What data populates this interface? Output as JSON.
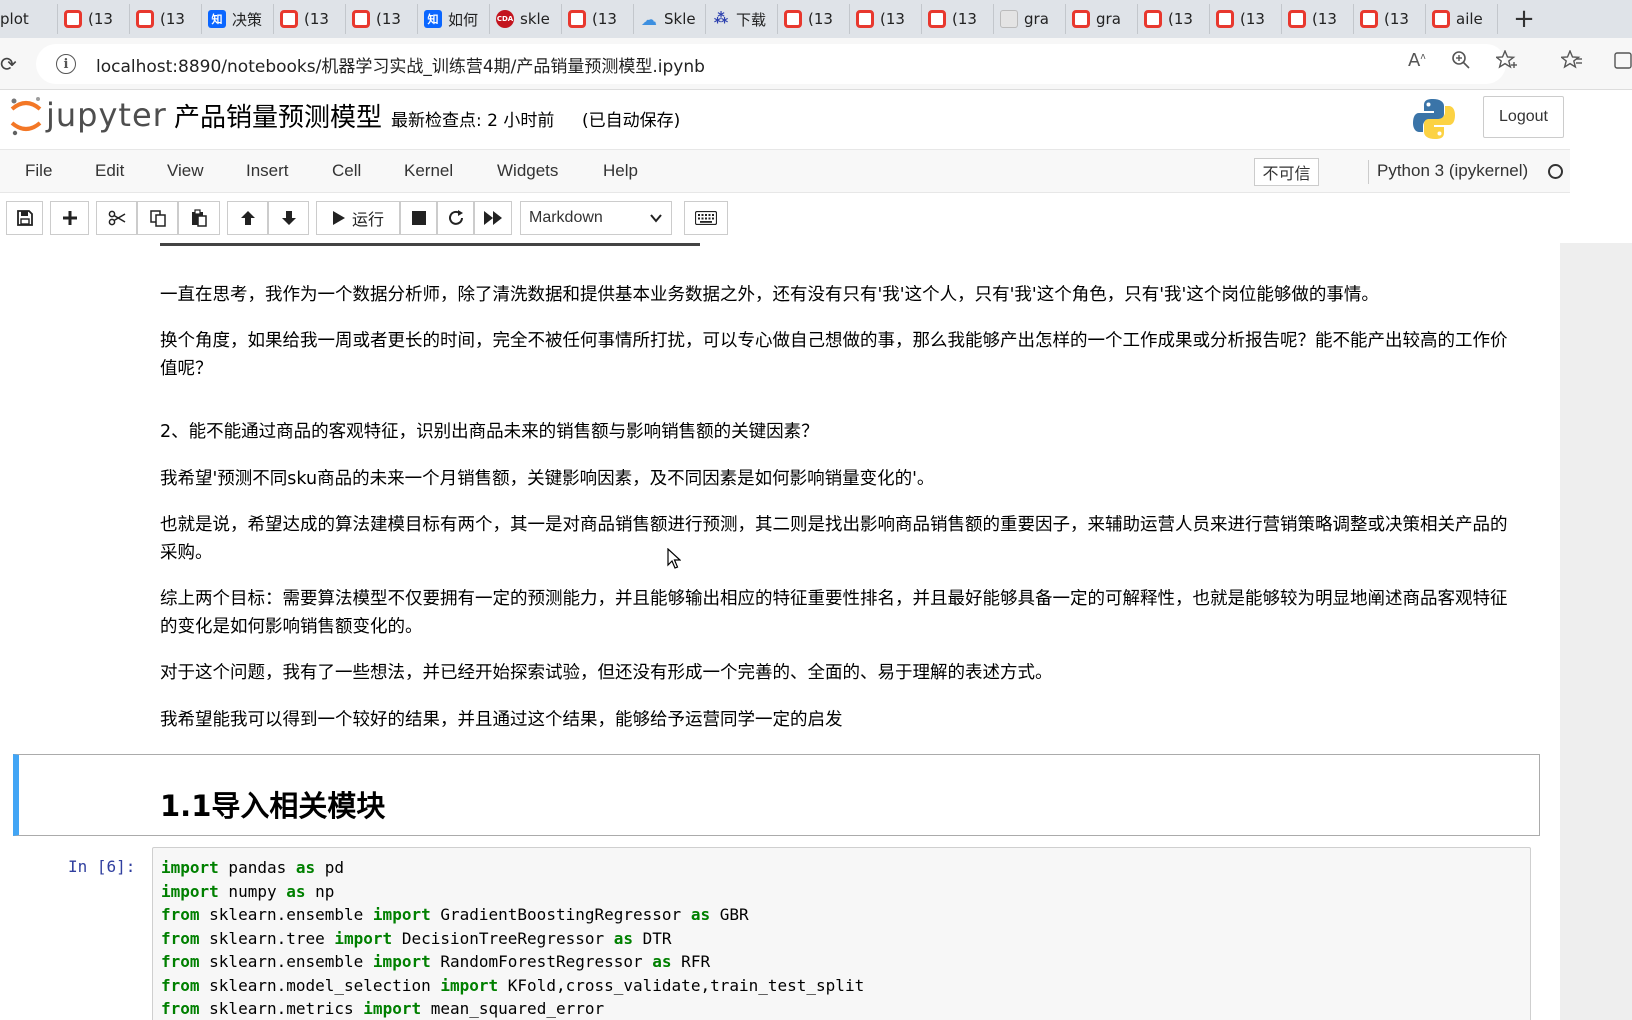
{
  "browser": {
    "tabs": [
      {
        "label": "plot",
        "icon": "none"
      },
      {
        "label": "(13",
        "icon": "c"
      },
      {
        "label": "(13",
        "icon": "c"
      },
      {
        "label": "决策",
        "icon": "zhi"
      },
      {
        "label": "(13",
        "icon": "c"
      },
      {
        "label": "(13",
        "icon": "c"
      },
      {
        "label": "如何",
        "icon": "zhi"
      },
      {
        "label": "skle",
        "icon": "cda"
      },
      {
        "label": "(13",
        "icon": "c"
      },
      {
        "label": "Skle",
        "icon": "cloud"
      },
      {
        "label": "下载",
        "icon": "tri"
      },
      {
        "label": "(13",
        "icon": "c"
      },
      {
        "label": "(13",
        "icon": "c"
      },
      {
        "label": "(13",
        "icon": "c"
      },
      {
        "label": "gra",
        "icon": "gray"
      },
      {
        "label": "gra",
        "icon": "c"
      },
      {
        "label": "(13",
        "icon": "c"
      },
      {
        "label": "(13",
        "icon": "c"
      },
      {
        "label": "(13",
        "icon": "c"
      },
      {
        "label": "(13",
        "icon": "c"
      },
      {
        "label": "aile",
        "icon": "c"
      }
    ],
    "icon_text": {
      "zhi": "知",
      "cda": "CDA",
      "cloud": "☁",
      "tri": "⁂"
    },
    "new_tab": "+",
    "url": "localhost:8890/notebooks/机器学习实战_训练营4期/产品销量预测模型.ipynb"
  },
  "jupyter": {
    "logo_text": "jupyter",
    "notebook_title": "产品销量预测模型",
    "checkpoint": "最新检查点: 2 小时前",
    "autosave": "(已自动保存)",
    "logout": "Logout"
  },
  "menubar": {
    "items": [
      "File",
      "Edit",
      "View",
      "Insert",
      "Cell",
      "Kernel",
      "Widgets",
      "Help"
    ],
    "trust": "不可信",
    "kernel": "Python 3 (ipykernel)"
  },
  "toolbar": {
    "run_label": "运行",
    "cell_type": "Markdown"
  },
  "notebook": {
    "paragraphs": [
      "一直在思考，我作为一个数据分析师，除了清洗数据和提供基本业务数据之外，还有没有只有'我'这个人，只有'我'这个角色，只有'我'这个岗位能够做的事情。",
      "换个角度，如果给我一周或者更长的时间，完全不被任何事情所打扰，可以专心做自己想做的事，那么我能够产出怎样的一个工作成果或分析报告呢？能不能产出较高的工作价值呢？",
      "2、能不能通过商品的客观特征，识别出商品未来的销售额与影响销售额的关键因素？",
      "我希望'预测不同sku商品的未来一个月销售额，关键影响因素，及不同因素是如何影响销量变化的'。",
      "也就是说，希望达成的算法建模目标有两个，其一是对商品销售额进行预测，其二则是找出影响商品销售额的重要因子，来辅助运营人员来进行营销策略调整或决策相关产品的采购。",
      "综上两个目标：需要算法模型不仅要拥有一定的预测能力，并且能够输出相应的特征重要性排名，并且最好能够具备一定的可解释性，也就是能够较为明显地阐述商品客观特征的变化是如何影响销售额变化的。",
      "对于这个问题，我有了一些想法，并已经开始探索试验，但还没有形成一个完善的、全面的、易于理解的表述方式。",
      "我希望能我可以得到一个较好的结果，并且通过这个结果，能够给予运营同学一定的启发"
    ],
    "heading": "1.1导入相关模块",
    "code_prompt": "In  [6]:",
    "code_lines": [
      [
        [
          "kw",
          "import"
        ],
        [
          "t",
          " pandas "
        ],
        [
          "kw",
          "as"
        ],
        [
          "t",
          " pd"
        ]
      ],
      [
        [
          "kw",
          "import"
        ],
        [
          "t",
          " numpy "
        ],
        [
          "kw",
          "as"
        ],
        [
          "t",
          " np"
        ]
      ],
      [
        [
          "kw",
          "from"
        ],
        [
          "t",
          " sklearn.ensemble "
        ],
        [
          "kw",
          "import"
        ],
        [
          "t",
          " GradientBoostingRegressor "
        ],
        [
          "kw",
          "as"
        ],
        [
          "t",
          " GBR"
        ]
      ],
      [
        [
          "kw",
          "from"
        ],
        [
          "t",
          " sklearn.tree "
        ],
        [
          "kw",
          "import"
        ],
        [
          "t",
          " DecisionTreeRegressor "
        ],
        [
          "kw",
          "as"
        ],
        [
          "t",
          " DTR"
        ]
      ],
      [
        [
          "kw",
          "from"
        ],
        [
          "t",
          " sklearn.ensemble "
        ],
        [
          "kw",
          "import"
        ],
        [
          "t",
          " RandomForestRegressor "
        ],
        [
          "kw",
          "as"
        ],
        [
          "t",
          " RFR"
        ]
      ],
      [
        [
          "kw",
          "from"
        ],
        [
          "t",
          " sklearn.model_selection "
        ],
        [
          "kw",
          "import"
        ],
        [
          "t",
          " KFold,cross_validate,train_test_split"
        ]
      ],
      [
        [
          "kw",
          "from"
        ],
        [
          "t",
          " sklearn.metrics "
        ],
        [
          "kw",
          "import"
        ],
        [
          "t",
          " mean_squared_error"
        ]
      ]
    ]
  },
  "colors": {
    "tabstrip": "#dfe3e8",
    "heading_border_accent": "#42a5f5",
    "keyword": "#008000",
    "prompt": "#303f9f",
    "jupyter_orange": "#f37726"
  }
}
